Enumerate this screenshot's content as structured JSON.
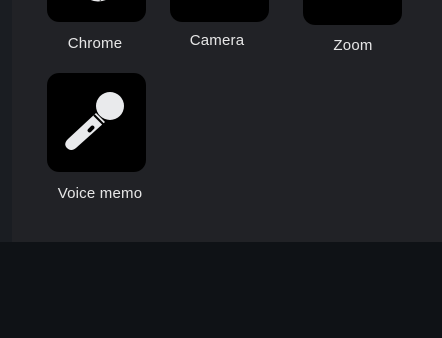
{
  "apps": [
    {
      "label": "Chrome",
      "icon": "chrome-icon"
    },
    {
      "label": "Camera",
      "icon": "camera-icon"
    },
    {
      "label": "Zoom",
      "icon": "zoom-icon"
    },
    {
      "label": "Voice memo",
      "icon": "microphone-icon"
    }
  ],
  "colors": {
    "panel": "#212226",
    "background": "#0f1216",
    "tile": "#000000",
    "label_text": "#e6e6e6",
    "icon_fill": "#e9eaec"
  }
}
